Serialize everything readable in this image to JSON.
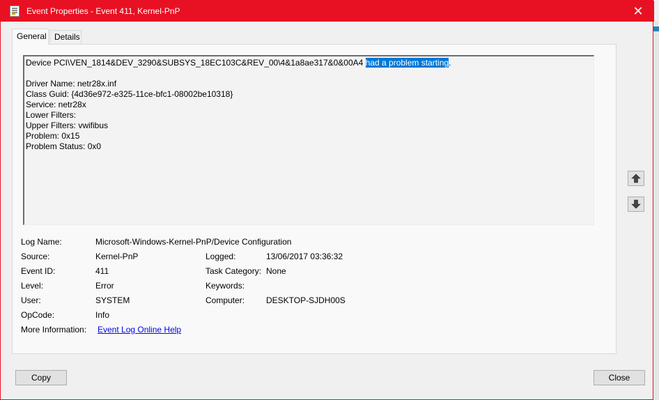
{
  "window": {
    "title": "Event Properties - Event 411, Kernel-PnP",
    "close_glyph": "✕"
  },
  "tabs": [
    {
      "label": "General",
      "active": true
    },
    {
      "label": "Details",
      "active": false
    }
  ],
  "description": {
    "line1_prefix": "Device PCI\\VEN_1814&DEV_3290&SUBSYS_18EC103C&REV_00\\4&1a8ae317&0&00A4 ",
    "line1_highlight": "had a problem starting",
    "line1_suffix": ".",
    "lines": [
      "Driver Name: netr28x.inf",
      "Class Guid: {4d36e972-e325-11ce-bfc1-08002be10318}",
      "Service: netr28x",
      "Lower Filters:",
      "Upper Filters: vwifibus",
      "Problem: 0x15",
      "Problem Status: 0x0"
    ]
  },
  "fields": {
    "log_name_label": "Log Name:",
    "log_name_value": "Microsoft-Windows-Kernel-PnP/Device Configuration",
    "source_label": "Source:",
    "source_value": "Kernel-PnP",
    "logged_label": "Logged:",
    "logged_value": "13/06/2017 03:36:32",
    "event_id_label": "Event ID:",
    "event_id_value": "411",
    "task_category_label": "Task Category:",
    "task_category_value": "None",
    "level_label": "Level:",
    "level_value": "Error",
    "keywords_label": "Keywords:",
    "keywords_value": "",
    "user_label": "User:",
    "user_value": "SYSTEM",
    "computer_label": "Computer:",
    "computer_value": "DESKTOP-SJDH00S",
    "opcode_label": "OpCode:",
    "opcode_value": "Info",
    "more_info_label": "More Information:",
    "more_info_link": "Event Log Online Help"
  },
  "buttons": {
    "copy": "Copy",
    "close": "Close",
    "up_icon": "arrow-up-icon",
    "down_icon": "arrow-down-icon"
  },
  "colors": {
    "titlebar": "#e81123",
    "highlight": "#0078d7",
    "link": "#0000ee"
  }
}
